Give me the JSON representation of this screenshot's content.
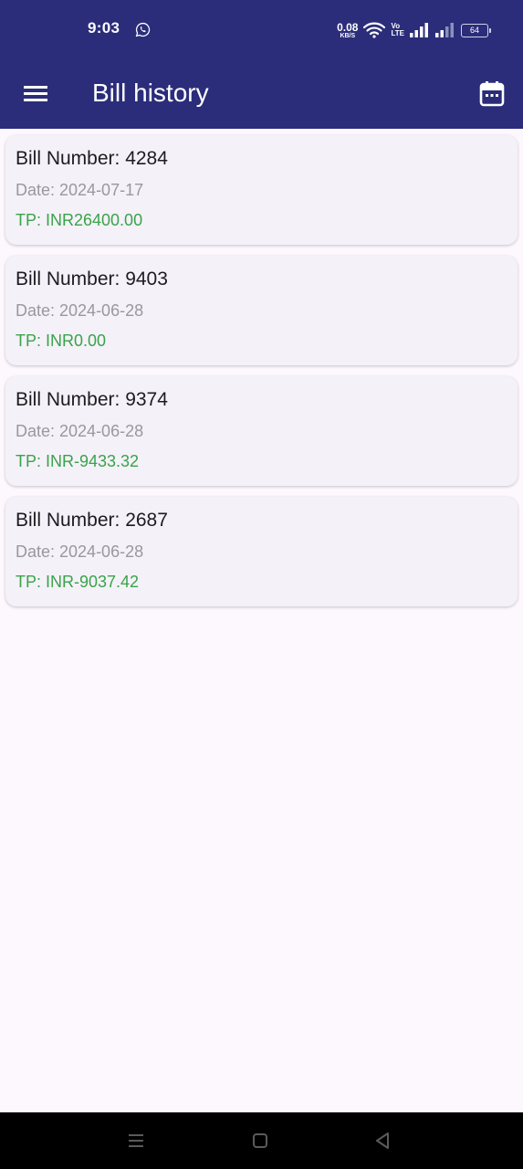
{
  "status_bar": {
    "time": "9:03",
    "net_speed_value": "0.08",
    "net_speed_unit": "KB/S",
    "volte_top": "Vo",
    "volte_bottom": "LTE",
    "battery": "64",
    "icons": [
      "whatsapp-icon",
      "wifi-icon",
      "signal-icon",
      "battery-icon"
    ]
  },
  "app_bar": {
    "title": "Bill history",
    "icons": [
      "menu-icon",
      "calendar-icon"
    ],
    "color": "#2b2d7a"
  },
  "bills": [
    {
      "number": "Bill Number: 4284",
      "date": "Date: 2024-07-17",
      "tp": "TP: INR26400.00"
    },
    {
      "number": "Bill Number: 9403",
      "date": "Date: 2024-06-28",
      "tp": "TP: INR0.00"
    },
    {
      "number": "Bill Number: 9374",
      "date": "Date: 2024-06-28",
      "tp": "TP: INR-9433.32"
    },
    {
      "number": "Bill Number: 2687",
      "date": "Date: 2024-06-28",
      "tp": "TP: INR-9037.42"
    }
  ],
  "colors": {
    "accent": "#2b2d7a",
    "amount": "#3aa34a",
    "date": "#9b989c"
  },
  "nav_bar": {
    "icons": [
      "recents-icon",
      "home-icon",
      "back-icon"
    ]
  }
}
